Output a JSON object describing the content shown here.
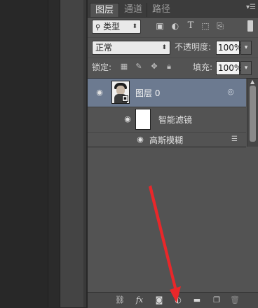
{
  "tabs": [
    "图层",
    "通道",
    "路径"
  ],
  "panel_menu_icon": "panel-menu-icon",
  "filter": {
    "kind_label": "类型",
    "kind_icon": "search-icon",
    "icons": [
      "image-filter-icon",
      "adjustment-filter-icon",
      "type-filter-icon",
      "shape-filter-icon",
      "smart-object-filter-icon"
    ]
  },
  "blend": {
    "mode": "正常",
    "opacity_label": "不透明度:",
    "opacity_value": "100%"
  },
  "locks": {
    "label": "锁定:",
    "icons": [
      "lock-transparent-pixels-icon",
      "lock-image-pixels-icon",
      "lock-position-icon",
      "lock-all-icon"
    ],
    "fill_label": "填充:",
    "fill_value": "100%"
  },
  "layers": [
    {
      "name": "图层 0",
      "visible": true,
      "selected": true,
      "type": "smart-object"
    },
    {
      "name": "智能滤镜",
      "visible": true,
      "type": "smart-filters"
    },
    {
      "name": "高斯模糊",
      "visible": true,
      "type": "filter"
    }
  ],
  "footer_icons": [
    "link-layers-icon",
    "fx-icon",
    "add-mask-icon",
    "new-adjustment-layer-icon",
    "new-group-icon",
    "new-layer-icon",
    "delete-layer-icon"
  ],
  "footer_fx_label": "fx",
  "annotation_color": "#e8272a",
  "selection_color": "#6c7a90"
}
